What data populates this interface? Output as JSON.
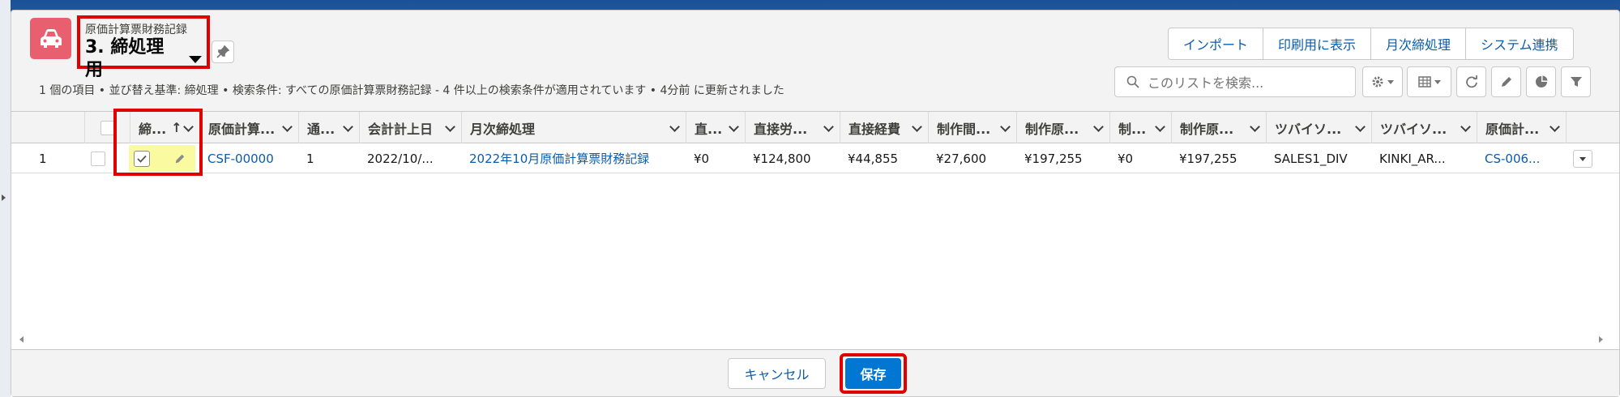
{
  "header": {
    "object_label": "原価計算票財務記録",
    "list_view_name": "3. 締処理用",
    "summary": "1 個の項目 • 並び替え基準: 締処理 • 検索条件: すべての原価計算票財務記録 - 4 件以上の検索条件が適用されています • 4分前 に更新されました"
  },
  "actions": [
    "インポート",
    "印刷用に表示",
    "月次締処理",
    "システム連携"
  ],
  "search": {
    "placeholder": "このリストを検索..."
  },
  "columns": [
    {
      "label": "締...",
      "sort": "↑"
    },
    {
      "label": "原価計算..."
    },
    {
      "label": "通..."
    },
    {
      "label": "会計計上日"
    },
    {
      "label": "月次締処理"
    },
    {
      "label": "直..."
    },
    {
      "label": "直接労..."
    },
    {
      "label": "直接経費"
    },
    {
      "label": "制作間..."
    },
    {
      "label": "制作原..."
    },
    {
      "label": "制..."
    },
    {
      "label": "制作原..."
    },
    {
      "label": "ツバイソ..."
    },
    {
      "label": "ツバイソ..."
    },
    {
      "label": "原価計..."
    }
  ],
  "rows": [
    {
      "row_number": "1",
      "cells": [
        "CSF-00000",
        "1",
        "2022/10/...",
        "2022年10月原価計算票財務記録",
        "¥0",
        "¥124,800",
        "¥44,855",
        "¥27,600",
        "¥197,255",
        "¥0",
        "¥197,255",
        "SALES1_DIV",
        "KINKI_AR...",
        "CS-006..."
      ]
    }
  ],
  "footer": {
    "cancel_label": "キャンセル",
    "save_label": "保存"
  },
  "colors": {
    "accent": "#0176d3",
    "link": "#0b5cab",
    "highlight": "#e00000",
    "edited_cell": "#fafaa0",
    "object_icon": "#e8606f"
  },
  "icons": [
    "car-icon",
    "pin-icon",
    "search-icon",
    "gear-icon",
    "table-view-icon",
    "refresh-icon",
    "pencil-icon",
    "chart-icon",
    "filter-icon",
    "check-icon",
    "sort-up-icon"
  ]
}
